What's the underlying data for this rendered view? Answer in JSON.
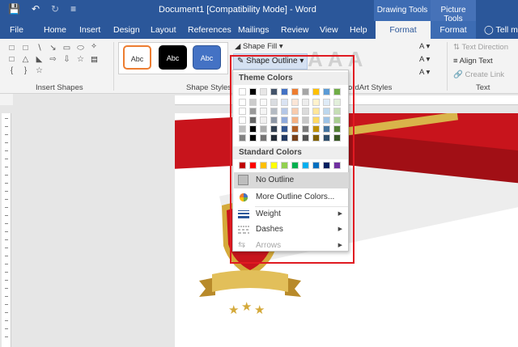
{
  "window": {
    "doc_title": "Document1 [Compatibility Mode] - Word",
    "contextual_tabs": [
      "Drawing Tools",
      "Picture Tools"
    ],
    "tell_me": "Tell m"
  },
  "tabs": [
    "File",
    "Home",
    "Insert",
    "Design",
    "Layout",
    "References",
    "Mailings",
    "Review",
    "View",
    "Help",
    "Format",
    "Format"
  ],
  "ribbon": {
    "insert_shapes_label": "Insert Shapes",
    "shape_styles_label": "Shape Styles",
    "wordart_label": "ordArt Styles",
    "text_label": "Text",
    "style_sample": "Abc",
    "shape_fill": "Shape Fill",
    "shape_outline": "Shape Outline",
    "text_direction": "Text Direction",
    "align_text": "Align Text",
    "create_link": "Create Link",
    "wordart_letter": "A"
  },
  "dropdown": {
    "theme_colors_label": "Theme Colors",
    "standard_colors_label": "Standard Colors",
    "no_outline": "No Outline",
    "more_colors": "More Outline Colors...",
    "weight": "Weight",
    "dashes": "Dashes",
    "arrows": "Arrows",
    "theme_top_row": [
      "#ffffff",
      "#000000",
      "#e7e6e6",
      "#44546a",
      "#4472c4",
      "#ed7d31",
      "#a5a5a5",
      "#ffc000",
      "#5b9bd5",
      "#70ad47",
      "#ed7d31"
    ],
    "standard_row": [
      "#c00000",
      "#ff0000",
      "#ffc000",
      "#ffff00",
      "#92d050",
      "#00b050",
      "#00b0f0",
      "#0070c0",
      "#002060",
      "#7030a0"
    ]
  },
  "colors": {
    "accent": "#2b579a",
    "highlight_border": "#e01a22"
  }
}
